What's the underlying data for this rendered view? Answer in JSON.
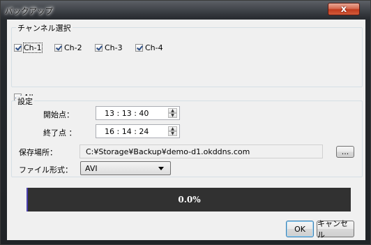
{
  "window": {
    "title": "バックアップ",
    "close_glyph": "x"
  },
  "channel_group": {
    "legend": "チャンネル選択",
    "channels": [
      {
        "label": "Ch-1",
        "checked": true
      },
      {
        "label": "Ch-2",
        "checked": true
      },
      {
        "label": "Ch-3",
        "checked": true
      },
      {
        "label": "Ch-4",
        "checked": true
      }
    ],
    "all": {
      "label": "All",
      "checked": true
    }
  },
  "settings_group": {
    "legend": "設定",
    "start_label": "開始点：",
    "start_value": "13 : 13 : 40",
    "end_label": "終了点 ：",
    "end_value": "16 : 14 : 24"
  },
  "save": {
    "label": "保存場所：",
    "path": "C:¥Storage¥Backup¥demo-d1.okddns.com",
    "browse_label": "..."
  },
  "format": {
    "label": "ファイル形式：",
    "selected": "AVI"
  },
  "progress": {
    "text": "0.0%",
    "fraction": 0.0
  },
  "buttons": {
    "ok": "OK",
    "cancel": "キャンセル"
  },
  "colors": {
    "progress_bg": "#313131",
    "close_red": "#c13b1d",
    "accent": "#3c7fb1"
  }
}
